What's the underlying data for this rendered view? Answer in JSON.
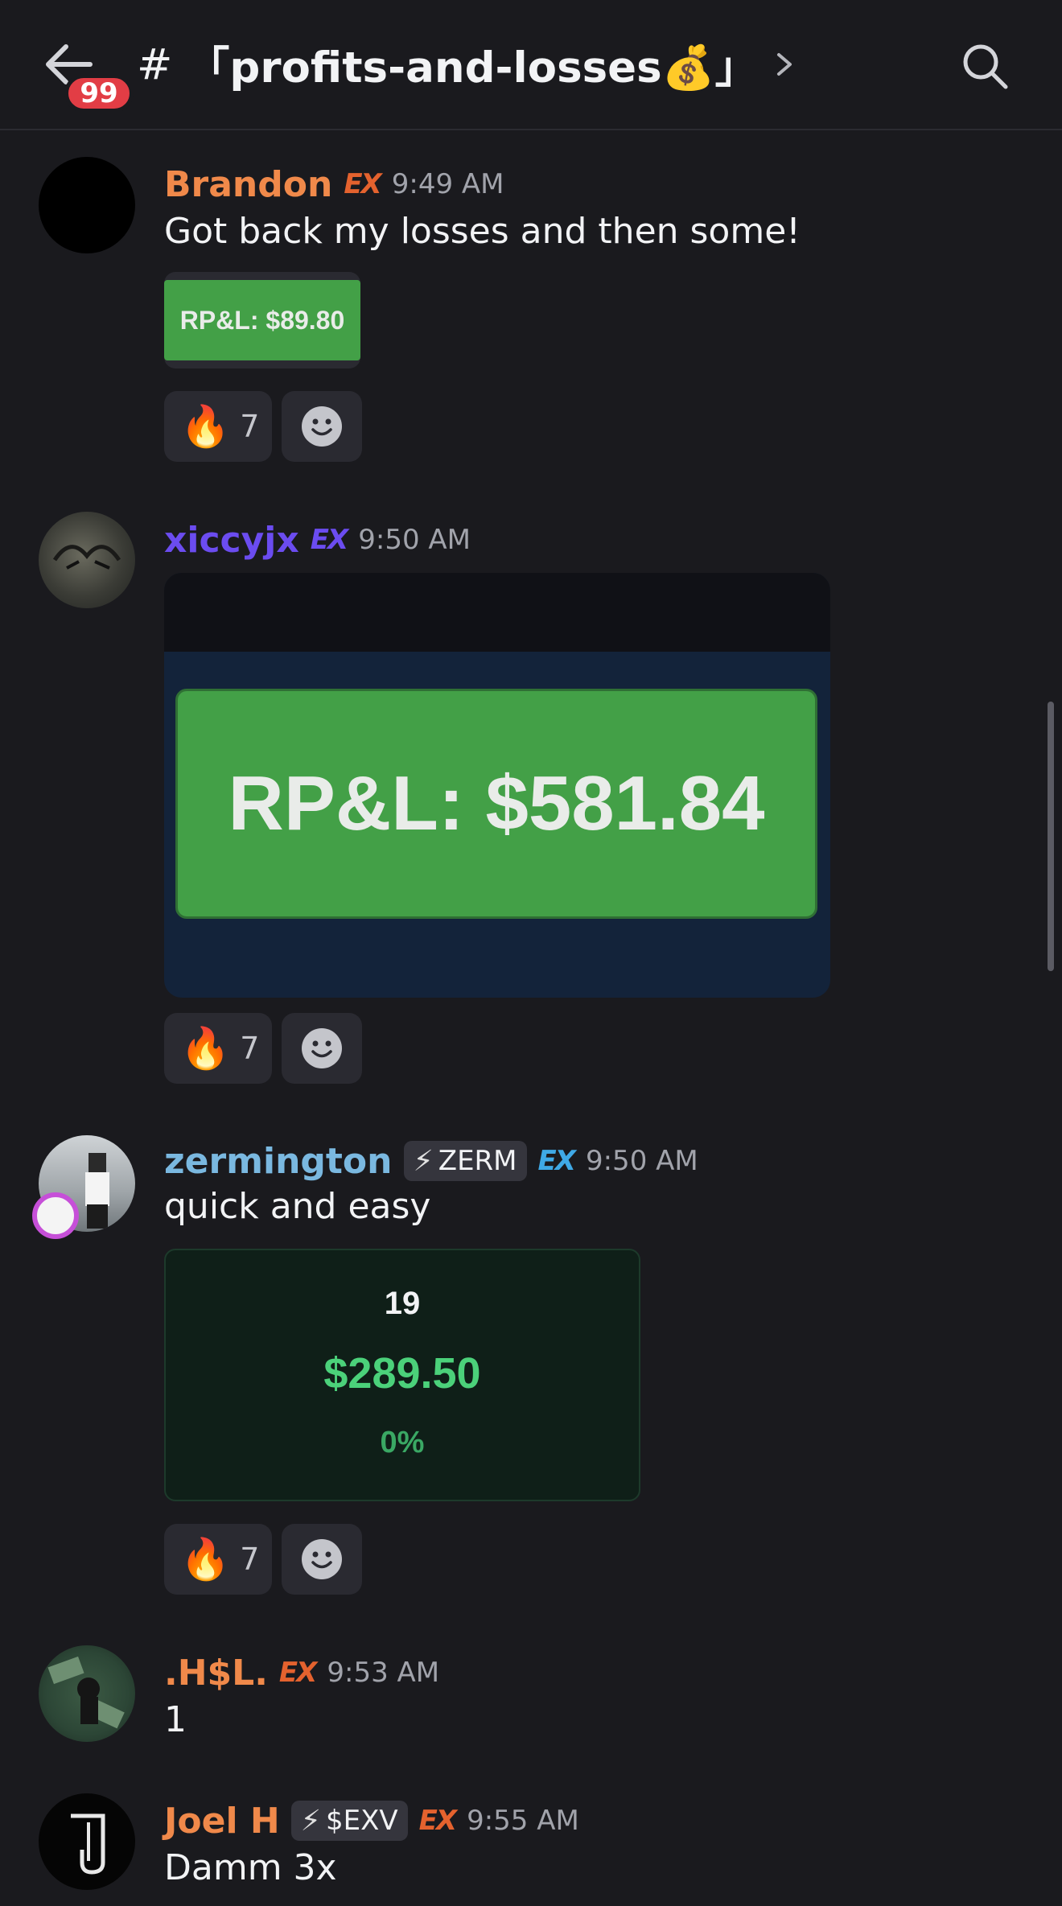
{
  "header": {
    "unread_count": "99",
    "channel_name": "「profits-and-losses💰」",
    "hash": "#"
  },
  "messages": [
    {
      "username": "Brandon",
      "username_color": "#f0894a",
      "ex_color": "#e4622e",
      "time": "9:49 AM",
      "text": "Got back my losses and then some!",
      "image_text": "RP&L: $89.80",
      "reaction_emoji": "🔥",
      "reaction_count": "7"
    },
    {
      "username": "xiccyjx",
      "username_color": "#6b4cf0",
      "ex_color": "#6b4cf0",
      "time": "9:50 AM",
      "image_text": "RP&L: $581.84",
      "reaction_emoji": "🔥",
      "reaction_count": "7"
    },
    {
      "username": "zermington",
      "username_color": "#7ab8e0",
      "role_tag": "ZERM",
      "ex_color": "#3fa9e6",
      "time": "9:50 AM",
      "text": "quick and easy",
      "image_line1": "19",
      "image_line2": "$289.50",
      "image_line3": "0%",
      "reaction_emoji": "🔥",
      "reaction_count": "7"
    },
    {
      "username": ".H$L.",
      "username_color": "#f0894a",
      "ex_color": "#e4622e",
      "time": "9:53 AM",
      "text": "1"
    },
    {
      "username": "Joel H",
      "username_color": "#f0894a",
      "role_tag": "$EXV",
      "ex_color": "#e4622e",
      "time": "9:55 AM",
      "text": "Damm 3x"
    }
  ],
  "ex_label": "EX",
  "bolt": "⚡",
  "icons": {
    "back": "back-arrow-icon",
    "search": "search-icon",
    "add_reaction": "add-reaction-icon",
    "chevron": "chevron-right-icon"
  },
  "colors": {
    "background": "#1a1a1e",
    "badge": "#e23d45",
    "pnl_green": "#43a047"
  }
}
